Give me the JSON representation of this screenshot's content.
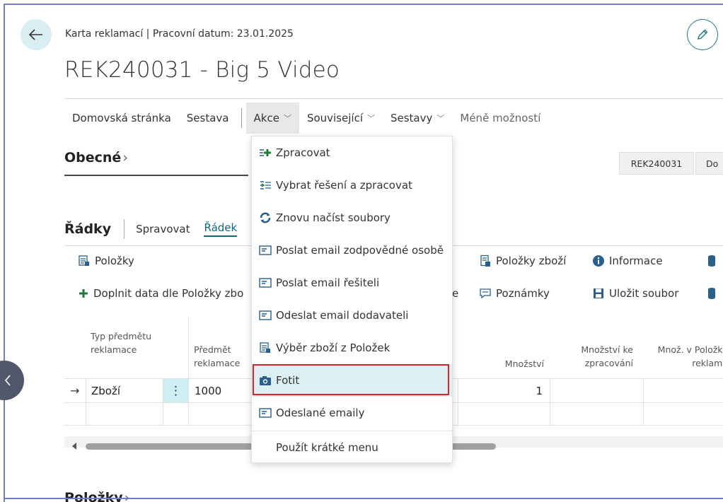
{
  "header": {
    "breadcrumb": "Karta reklamací | Pracovní datum: 23.01.2025",
    "title": "REK240031 - Big 5 Video"
  },
  "actionbar": {
    "home": "Domovská stránka",
    "report": "Sestava",
    "actions": "Akce",
    "related": "Související",
    "reports": "Sestavy",
    "fewer": "Méně možností"
  },
  "general": {
    "title": "Obecné",
    "tag1": "REK240031",
    "tag2": "Do"
  },
  "lines": {
    "title": "Řádky",
    "tab_manage": "Spravovat",
    "tab_line": "Řádek",
    "tools": {
      "items": "Položky",
      "fill_data": "Doplnit data dle Položky zbo",
      "fill_suffix": "e",
      "item_lines": "Položky zboží",
      "notes": "Poznámky",
      "info": "Informace",
      "save_file": "Uložit soubor"
    },
    "columns": {
      "type": "Typ předmětu reklamace",
      "subject": "Předmět reklamace",
      "quantity": "Množství",
      "qty_process": "Množství ke zpracování",
      "qty_items": "Množ. v Položká reklama"
    },
    "rows": [
      {
        "type": "Zboží",
        "subject": "1000",
        "quantity": "1"
      }
    ]
  },
  "dropdown": {
    "items": [
      {
        "label": "Zpracovat",
        "icon": "plus-list-icon"
      },
      {
        "label": "Vybrat řešení a zpracovat",
        "icon": "select-list-icon"
      },
      {
        "label": "Znovu načíst soubory",
        "icon": "refresh-icon"
      },
      {
        "label": "Poslat email zodpovědné osobě",
        "icon": "email-card-icon"
      },
      {
        "label": "Poslat email řešiteli",
        "icon": "email-card-icon"
      },
      {
        "label": "Odeslat email dodavateli",
        "icon": "email-card-icon"
      },
      {
        "label": "Výběr zboží z Položek",
        "icon": "document-list-icon"
      },
      {
        "label": "Fotit",
        "icon": "camera-icon"
      },
      {
        "label": "Odeslané emaily",
        "icon": "email-card-icon"
      },
      {
        "label": "Použít krátké menu",
        "icon": ""
      }
    ]
  },
  "footer_section": {
    "title": "Položky"
  },
  "colors": {
    "accent": "#0f6b7a",
    "highlight": "#dcf0f4",
    "red_box": "#d7252e"
  }
}
